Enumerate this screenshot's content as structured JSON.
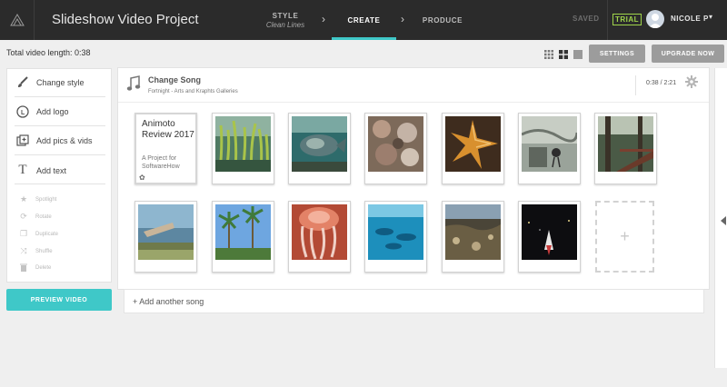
{
  "app": {
    "project_title": "Slideshow Video Project"
  },
  "steps": [
    {
      "label": "STYLE",
      "sub": "Clean Lines"
    },
    {
      "label": "CREATE"
    },
    {
      "label": "PRODUCE"
    }
  ],
  "status": {
    "saved": "SAVED",
    "trial": "TRIAL",
    "user": "NICOLE P"
  },
  "toolbar": {
    "total_length": "Total video length: 0:38",
    "settings_label": "SETTINGS",
    "upgrade_label": "UPGRADE NOW",
    "view_modes": [
      "large-grid-icon",
      "medium-grid-icon",
      "single-view-icon"
    ]
  },
  "tools": [
    {
      "label": "Change style",
      "icon": "brush-icon"
    },
    {
      "label": "Add logo",
      "icon": "logo-icon"
    },
    {
      "label": "Add pics & vids",
      "icon": "add-media-icon"
    },
    {
      "label": "Add text",
      "icon": "text-icon"
    }
  ],
  "secondary_tools": [
    "Spotlight",
    "Rotate",
    "Duplicate",
    "Shuffle",
    "Delete"
  ],
  "preview_label": "PREVIEW VIDEO",
  "song": {
    "title": "Change Song",
    "subtitle": "Fortnight - Arts and Kraphts Galleries",
    "time": "0:38 / 2:21"
  },
  "title_card": {
    "line1": "Animoto Review 2017",
    "line2": "A Project for SoftwareHow"
  },
  "media": [
    {
      "name": "kelp-forest-photo"
    },
    {
      "name": "fish-tank-photo"
    },
    {
      "name": "sea-anemone-photo"
    },
    {
      "name": "starfish-photo"
    },
    {
      "name": "aviary-photo"
    },
    {
      "name": "forest-deck-photo"
    },
    {
      "name": "pier-photo"
    },
    {
      "name": "palm-trees-photo"
    },
    {
      "name": "jellyfish-photo"
    },
    {
      "name": "swimming-fish-photo"
    },
    {
      "name": "rocky-shore-photo"
    },
    {
      "name": "night-boat-photo"
    }
  ],
  "add_tile_symbol": "+",
  "add_song_label": "+ Add another song",
  "colors": {
    "accent": "#3fc8c8",
    "topbar": "#2b2b2b",
    "trial": "#9fd44b"
  }
}
